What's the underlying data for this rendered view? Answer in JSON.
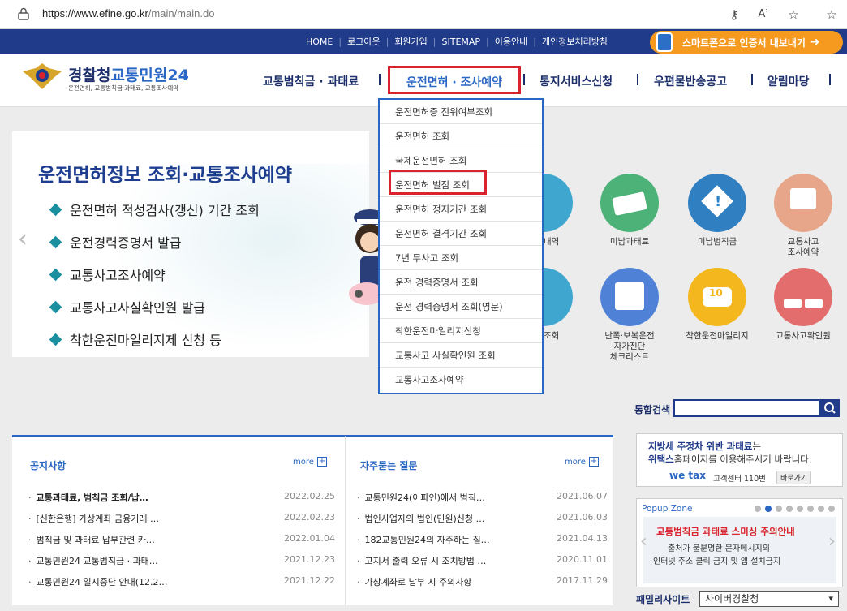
{
  "browser": {
    "url_host": "https://www.efine.go.kr",
    "url_path": "/main/main.do"
  },
  "top_links": [
    "HOME",
    "로그아웃",
    "회원가입",
    "SITEMAP",
    "이용안내",
    "개인정보처리방침"
  ],
  "smart_button": "스마트폰으로 인증서 내보내기",
  "logo": {
    "title_a": "경찰청",
    "title_b": "교통민원24",
    "subtitle": "운전면허, 교통범칙금·과태료, 교통조사예약"
  },
  "gnb": [
    "교통범칙금 · 과태료",
    "운전면허 · 조사예약",
    "통지서비스신청",
    "우편물반송공고",
    "알림마당"
  ],
  "banner": {
    "title": "운전면허정보 조회·교통조사예약",
    "items": [
      "운전면허 적성검사(갱신) 기간 조회",
      "운전경력증명서 발급",
      "교통사고조사예약",
      "교통사고사실확인원 발급",
      "착한운전마일리지제 신청 등"
    ]
  },
  "dropdown": [
    "운전면허증 진위여부조회",
    "운전면허 조회",
    "국제운전면허 조회",
    "운전면허 벌점 조회",
    "운전면허 정지기간 조회",
    "운전면허 결격기간 조회",
    "7년 무사고 조회",
    "운전 경력증명서 조회",
    "운전 경력증명서 조회(영문)",
    "착한운전마일리지신청",
    "교통사고 사실확인원 조회",
    "교통사고조사예약"
  ],
  "services": [
    {
      "label": "단속내역",
      "color": "#3fa7cf"
    },
    {
      "label": "미납과태료",
      "color": "#4cb277"
    },
    {
      "label": "미납범칙금",
      "color": "#2f7fc1"
    },
    {
      "label": "교통사고\n조사예약",
      "color": "#e7a58a"
    },
    {
      "label": "면허조회",
      "color": "#3fa7cf"
    },
    {
      "label": "난폭·보복운전\n자가진단\n체크리스트",
      "color": "#4f82d6"
    },
    {
      "label": "착한운전마일리지",
      "color": "#f4b71e"
    },
    {
      "label": "교통사고확인원",
      "color": "#e36d6d"
    }
  ],
  "search": {
    "label": "통합검색",
    "value": ""
  },
  "notices": {
    "title": "공지사항",
    "more": "more",
    "rows": [
      {
        "title": "교통과태료, 범칙금 조회/납…",
        "date": "2022.02.25"
      },
      {
        "title": "[신한은행] 가상계좌 금융거래 …",
        "date": "2022.02.23"
      },
      {
        "title": "범칙금 및 과태료 납부관련 카…",
        "date": "2022.01.04"
      },
      {
        "title": "교통민원24 교통범칙금 · 과태…",
        "date": "2021.12.23"
      },
      {
        "title": "교통민원24 일시중단 안내(12.2…",
        "date": "2021.12.22"
      }
    ]
  },
  "faq": {
    "title": "자주묻는 질문",
    "more": "more",
    "rows": [
      {
        "title": "교통민원24(이파인)에서 범칙…",
        "date": "2021.06.07"
      },
      {
        "title": "법인사업자의 법인(민원)신청 …",
        "date": "2021.06.03"
      },
      {
        "title": "182교통민원24의 자주하는 질…",
        "date": "2021.04.13"
      },
      {
        "title": "고지서 출력 오류 시 조치방법 …",
        "date": "2020.11.01"
      },
      {
        "title": "가상계좌로 납부 시 주의사항",
        "date": "2017.11.29"
      }
    ]
  },
  "wetax": {
    "line1a": "지방세 주정차 위반 과태료",
    "line1b": "는",
    "line2a": "위택스",
    "line2b": "홈페이지를 이용해주시기 바랍니다.",
    "logo": "we tax",
    "center": "고객센터 110번",
    "go": "바로가기"
  },
  "popup": {
    "title": "Popup Zone",
    "headline": "교통범칙금 과태료 스미싱 주의안내",
    "sub1": "출처가 불분명한 문자메시지의",
    "sub2": "인터넷 주소 클릭 금지 및 앱 설치금지"
  },
  "family": {
    "label": "패밀리사이트",
    "selected": "사이버경찰청"
  }
}
